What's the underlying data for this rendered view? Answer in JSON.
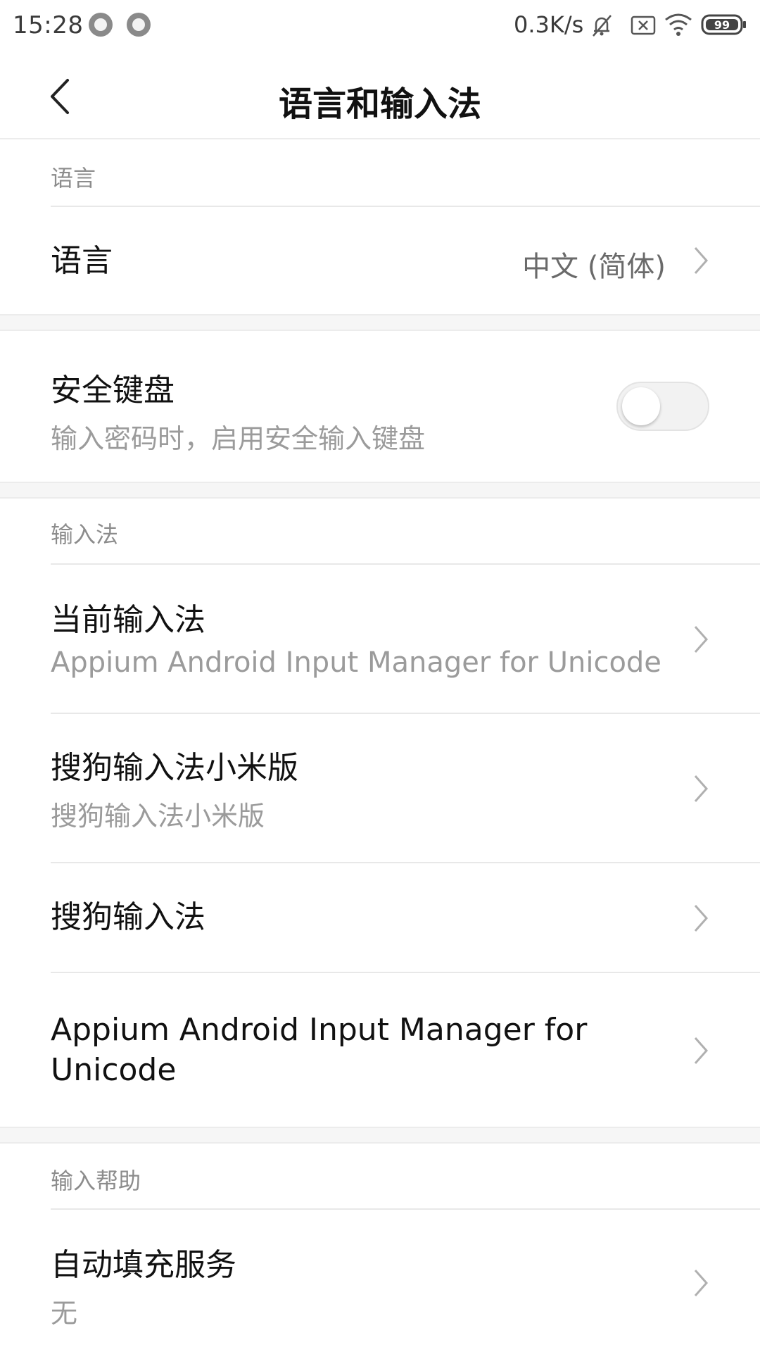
{
  "status_bar": {
    "time": "15:28",
    "network_speed": "0.3K/s",
    "battery": "99",
    "icons": [
      "notification-dot-icon",
      "notification-dot-icon",
      "mute-bell-icon",
      "sim-off-icon",
      "wifi-icon",
      "battery-icon"
    ]
  },
  "header": {
    "title": "语言和输入法",
    "back_icon": "back-arrow-icon"
  },
  "sections": {
    "language": {
      "title": "语言",
      "item_title": "语言",
      "item_value": "中文 (简体)"
    },
    "secure_keyboard": {
      "title": "安全键盘",
      "subtitle": "输入密码时，启用安全输入键盘",
      "enabled": false
    },
    "input_methods": {
      "title": "输入法",
      "items": [
        {
          "title": "当前输入法",
          "subtitle": "Appium Android Input Manager for Unicode"
        },
        {
          "title": "搜狗输入法小米版",
          "subtitle": "搜狗输入法小米版"
        },
        {
          "title": "搜狗输入法",
          "subtitle": ""
        },
        {
          "title": "Appium Android Input Manager for Unicode",
          "subtitle": ""
        }
      ]
    },
    "input_help": {
      "title": "输入帮助",
      "items": [
        {
          "title": "自动填充服务",
          "subtitle": "无"
        }
      ]
    }
  },
  "colors": {
    "accent_text": "#111111",
    "secondary_text": "#9b9b9b",
    "background": "#ffffff",
    "gap": "#f6f6f6"
  }
}
